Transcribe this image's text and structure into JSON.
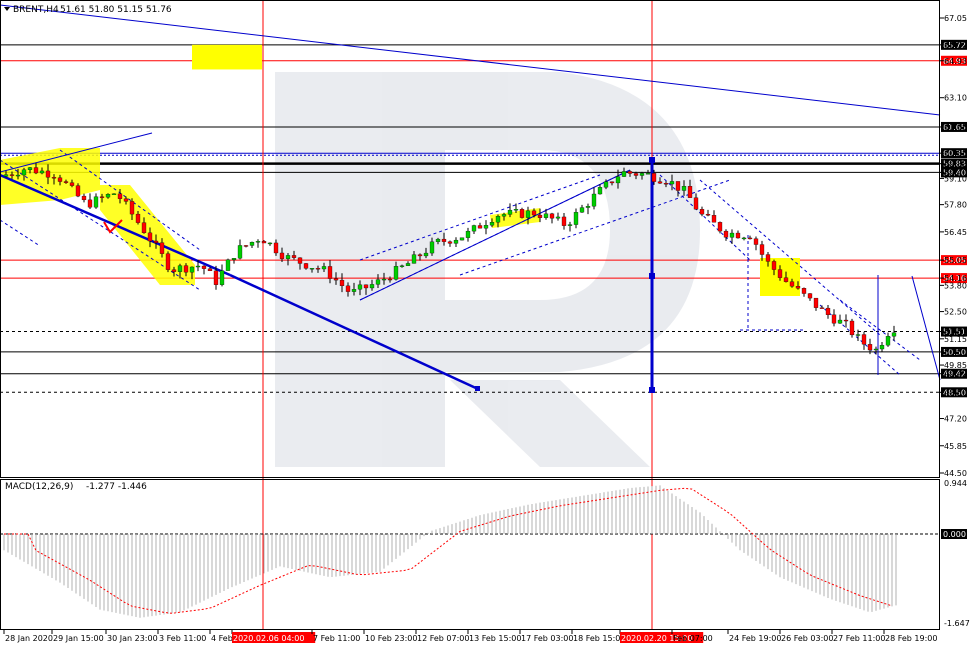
{
  "header": {
    "symbol": "BRENT,H4",
    "ohlc": "51.61 51.80 51.15 51.76"
  },
  "macd": {
    "label": "MACD(12,26,9)",
    "values": "-1.277 -1.446",
    "axis_labels": [
      "0.944",
      "0.000",
      "-1.647"
    ]
  },
  "colors": {
    "bull": "#00cc00",
    "bear": "#ff0000",
    "trend": "#0000cc",
    "highlight": "#ffff00",
    "level_red": "#ff0000",
    "vline_red": "#ff0000",
    "signal": "#ff0000",
    "histogram": "#b0b0b0"
  },
  "chart_data": {
    "type": "candlestick",
    "symbol": "BRENT",
    "timeframe": "H4",
    "price_axis_ticks": [
      "67.05",
      "65.72",
      "64.93",
      "63.10",
      "61.65",
      "60.35",
      "59.83",
      "59.40",
      "59.10",
      "57.80",
      "56.45",
      "55.05",
      "54.16",
      "53.80",
      "52.50",
      "51.51",
      "51.15",
      "50.50",
      "49.85",
      "49.42",
      "48.50",
      "47.20",
      "45.85",
      "44.50"
    ],
    "ylim": [
      44.5,
      67.6
    ],
    "time_ticks": [
      "28 Jan 2020",
      "29 Jan 15:00",
      "30 Jan 23:00",
      "3 Feb 11:00",
      "4 Feb",
      "2020.02.06 04:00",
      "7 Feb 11:00",
      "10 Feb 23:00",
      "12 Feb 07:00",
      "13 Feb 15:00",
      "17 Feb 03:00",
      "18 Feb 15:00",
      "2020.02.20 15:00",
      "Feb 07:00",
      "24 Feb 19:00",
      "26 Feb 03:00",
      "27 Feb 11:00",
      "28 Feb 19:00"
    ],
    "highlighted_time_labels": [
      "2020.02.06 04:00",
      "2020.02.20 15:00"
    ],
    "horizontal_levels": [
      {
        "price": 65.72,
        "label": "65.72",
        "color": "#000000"
      },
      {
        "price": 64.93,
        "label": "64.93",
        "color": "#ff0000"
      },
      {
        "price": 61.65,
        "label": "61.65",
        "color": "#000000"
      },
      {
        "price": 60.35,
        "label": "60.35",
        "color": "#0000cc"
      },
      {
        "price": 59.83,
        "label": "59.83",
        "color": "#000000"
      },
      {
        "price": 59.4,
        "label": "59.40",
        "color": "#000000"
      },
      {
        "price": 55.05,
        "label": "55.05",
        "color": "#ff0000"
      },
      {
        "price": 54.16,
        "label": "54.16",
        "color": "#ff0000"
      },
      {
        "price": 51.51,
        "label": "51.51",
        "color": "#000000"
      },
      {
        "price": 50.5,
        "label": "50.50",
        "color": "#000000"
      },
      {
        "price": 49.42,
        "label": "49.42",
        "color": "#000000"
      },
      {
        "price": 48.5,
        "label": "48.50",
        "color": "#000000"
      }
    ],
    "macd_axis": [
      0.944,
      0.0,
      -1.647
    ]
  }
}
